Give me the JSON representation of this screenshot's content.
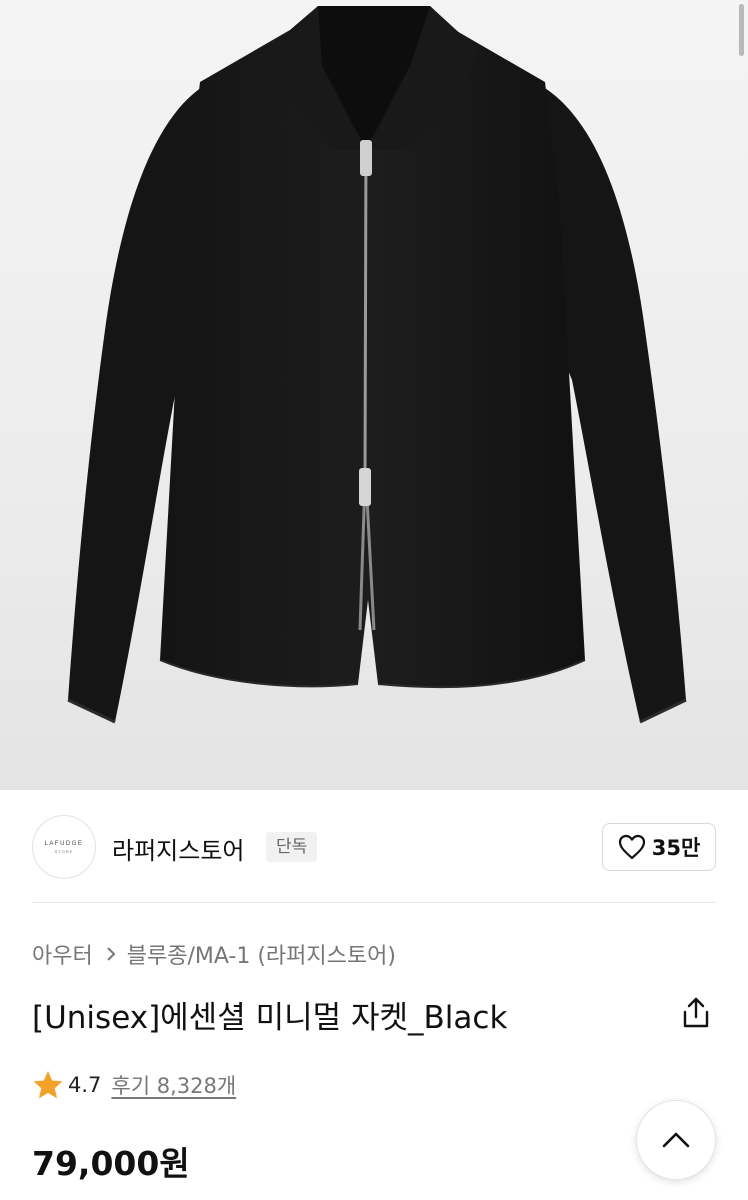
{
  "brand": {
    "logo_line1": "LAFUDGE",
    "logo_line2": "STORE",
    "name": "라퍼지스토어",
    "tag": "단독"
  },
  "like": {
    "count": "35만",
    "icon": "heart-outline-icon"
  },
  "breadcrumb": {
    "category": "아우터",
    "subcategory": "블루종/MA-1 (라퍼지스토어)",
    "separator_icon": "chevron-right-icon"
  },
  "product": {
    "title": "[Unisex]에센셜 미니멀 자켓_Black",
    "rating": "4.7",
    "reviews": "후기 8,328개",
    "price": "79,000원"
  },
  "colors": {
    "star": "#f2a12b",
    "text": "#111111",
    "muted": "#767676"
  }
}
